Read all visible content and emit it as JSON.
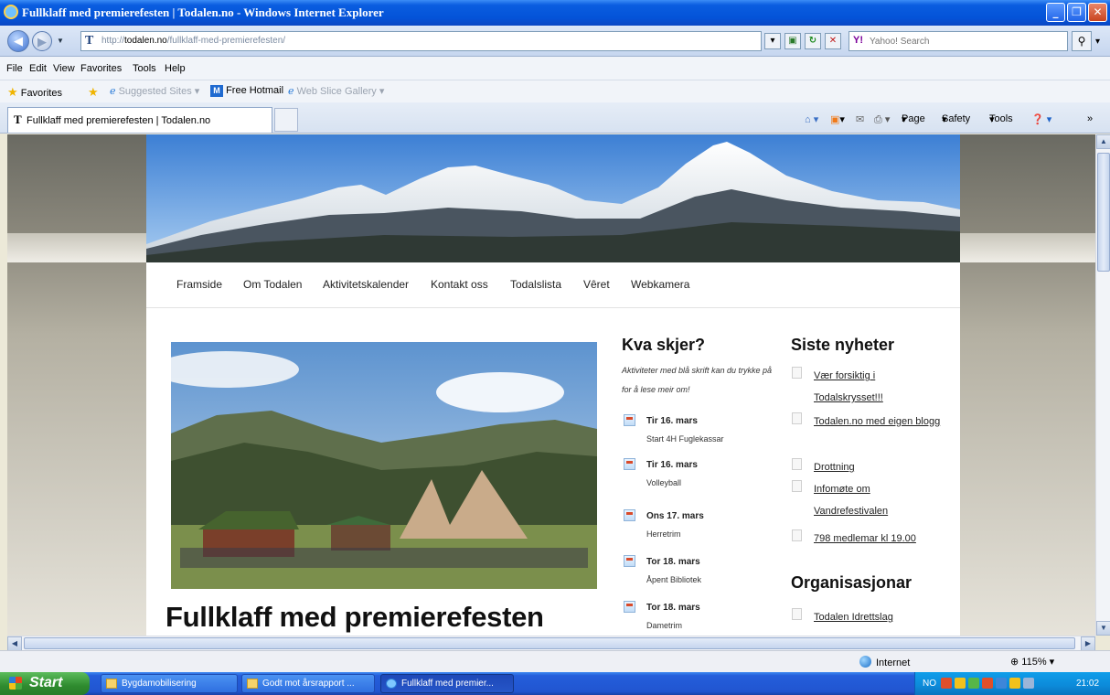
{
  "window": {
    "title": "Fullklaff med premierefesten | Todalen.no - Windows Internet Explorer"
  },
  "address": {
    "url_prefix": "http://",
    "url_domain": "todalen.no",
    "url_path": "/fullklaff-med-premierefesten/",
    "search_placeholder": "Yahoo! Search"
  },
  "menu": [
    "File",
    "Edit",
    "View",
    "Favorites",
    "Tools",
    "Help"
  ],
  "favorites_bar": {
    "favorites": "Favorites",
    "suggested": "Suggested Sites",
    "hotmail": "Free Hotmail",
    "webslice": "Web Slice Gallery"
  },
  "tab": {
    "title": "Fullklaff med premierefesten | Todalen.no"
  },
  "command_bar": {
    "page": "Page",
    "safety": "Safety",
    "tools": "Tools"
  },
  "site": {
    "nav": [
      "Framside",
      "Om Todalen",
      "Aktivitetskalender",
      "Kontakt oss",
      "Todalslista",
      "Vêret",
      "Webkamera"
    ],
    "headline": "Fullklaff med premierefesten",
    "events_title": "Kva skjer?",
    "events_intro": "Aktiviteter med blå skrift kan du trykke på for å lese meir om!",
    "events": [
      {
        "date": "Tir 16. mars",
        "name": "Start 4H Fuglekassar"
      },
      {
        "date": "Tir 16. mars",
        "name": "Volleyball"
      },
      {
        "date": "Ons 17. mars",
        "name": "Herretrim"
      },
      {
        "date": "Tor 18. mars",
        "name": "Åpent Bibliotek"
      },
      {
        "date": "Tor 18. mars",
        "name": "Dametrim"
      }
    ],
    "news_title": "Siste nyheter",
    "news": [
      "Vær forsiktig i Todalskrysset!!!",
      "Todalen.no med eigen blogg",
      "Drottning",
      "Infomøte om Vandrefestivalen",
      "798 medlemar kl 19.00"
    ],
    "org_title": "Organisasjonar",
    "orgs": [
      "Todalen Idrettslag"
    ]
  },
  "statusbar": {
    "zone": "Internet",
    "zoom": "115%"
  },
  "taskbar": {
    "start": "Start",
    "tasks": [
      "Bygdamobilisering",
      "Godt mot årsrapport ...",
      "Fullklaff med premier..."
    ],
    "lang": "NO",
    "clock": "21:02"
  }
}
